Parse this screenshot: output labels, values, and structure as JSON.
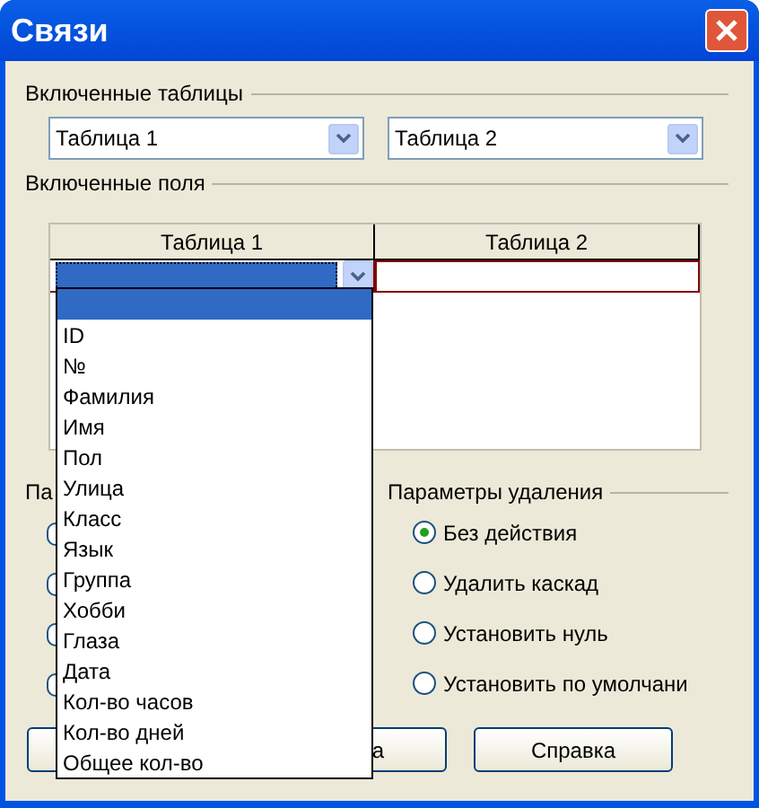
{
  "window": {
    "title": "Связи"
  },
  "included_tables": {
    "label": "Включенные таблицы",
    "combos": [
      {
        "value": "Таблица 1"
      },
      {
        "value": "Таблица 2"
      }
    ]
  },
  "included_fields": {
    "label": "Включенные поля",
    "columns": [
      "Таблица 1",
      "Таблица 2"
    ]
  },
  "update_options": {
    "label": "Па",
    "options": [
      {
        "kind": "radio"
      },
      {
        "kind": "radio"
      },
      {
        "kind": "radio"
      },
      {
        "kind": "radio"
      }
    ]
  },
  "delete_options": {
    "label": "Параметры удаления",
    "options": [
      {
        "label": "Без действия",
        "selected": true
      },
      {
        "label": "Удалить каскад",
        "selected": false
      },
      {
        "label": "Установить нуль",
        "selected": false
      },
      {
        "label": "Установить по умолчани",
        "selected": false
      }
    ]
  },
  "buttons": [
    {
      "kind": "ok"
    },
    {
      "kind": "cancel",
      "label": "а"
    },
    {
      "kind": "help",
      "label": "Справка"
    }
  ],
  "dropdown": {
    "items": [
      {
        "selected": true
      },
      {
        "label": "ID",
        "selected": false
      },
      {
        "label": "№",
        "selected": false
      },
      {
        "label": "Фамилия",
        "selected": false
      },
      {
        "label": "Имя",
        "selected": false
      },
      {
        "label": "Пол",
        "selected": false
      },
      {
        "label": "Улица",
        "selected": false
      },
      {
        "label": "Класс",
        "selected": false
      },
      {
        "label": "Язык",
        "selected": false
      },
      {
        "label": "Группа",
        "selected": false
      },
      {
        "label": "Хобби",
        "selected": false
      },
      {
        "label": "Глаза",
        "selected": false
      },
      {
        "label": "Дата",
        "selected": false
      },
      {
        "label": "Кол-во часов",
        "selected": false
      },
      {
        "label": "Кол-во дней",
        "selected": false
      },
      {
        "label": "Общее кол-во",
        "selected": false
      }
    ]
  }
}
